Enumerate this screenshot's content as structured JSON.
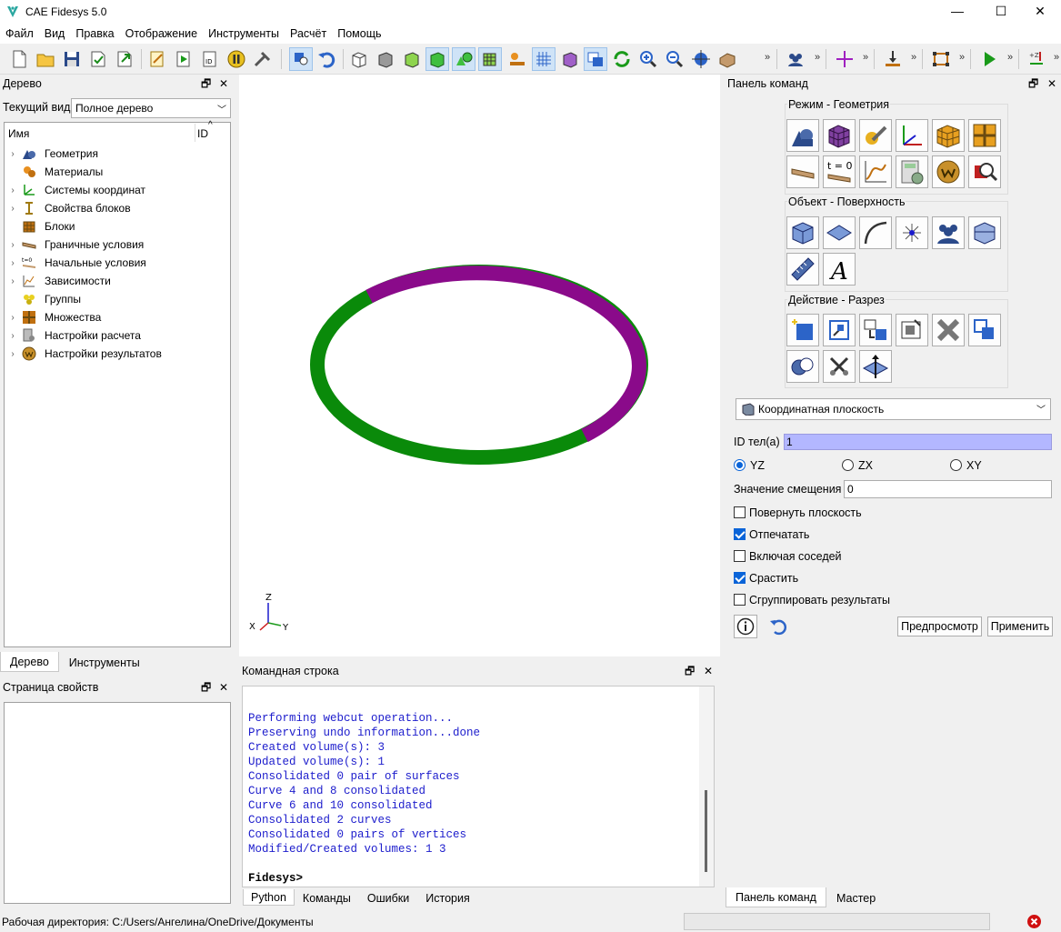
{
  "window": {
    "title": "CAE Fidesys 5.0",
    "minimize": "—",
    "maximize": "☐",
    "close": "✕"
  },
  "menu": [
    "Файл",
    "Вид",
    "Правка",
    "Отображение",
    "Инструменты",
    "Расчёт",
    "Помощь"
  ],
  "tree_panel": {
    "title": "Дерево",
    "view_label": "Текущий вид",
    "view_value": "Полное дерево",
    "col_name": "Имя",
    "col_id": "ID",
    "items": [
      {
        "label": "Геометрия",
        "icon": "geometry-icon",
        "expandable": true
      },
      {
        "label": "Материалы",
        "icon": "materials-icon",
        "expandable": false
      },
      {
        "label": "Системы координат",
        "icon": "coordinate-systems-icon",
        "expandable": true
      },
      {
        "label": "Свойства блоков",
        "icon": "block-properties-icon",
        "expandable": true
      },
      {
        "label": "Блоки",
        "icon": "blocks-icon",
        "expandable": false
      },
      {
        "label": "Граничные условия",
        "icon": "boundary-conditions-icon",
        "expandable": true
      },
      {
        "label": "Начальные условия",
        "icon": "initial-conditions-icon",
        "expandable": true
      },
      {
        "label": "Зависимости",
        "icon": "dependencies-icon",
        "expandable": true
      },
      {
        "label": "Группы",
        "icon": "groups-icon",
        "expandable": false
      },
      {
        "label": "Множества",
        "icon": "sets-icon",
        "expandable": true
      },
      {
        "label": "Настройки расчета",
        "icon": "analysis-settings-icon",
        "expandable": true
      },
      {
        "label": "Настройки результатов",
        "icon": "results-settings-icon",
        "expandable": true
      }
    ],
    "tabs": [
      "Дерево",
      "Инструменты"
    ]
  },
  "properties_panel": {
    "title": "Страница свойств"
  },
  "viewport": {
    "axis_z": "Z",
    "axis_y": "Y",
    "axis_x": "X",
    "colors": {
      "green": "#0a8a0a",
      "purple": "#8a0a8a"
    }
  },
  "command_line": {
    "title": "Командная строка",
    "lines": [
      "Performing webcut operation...",
      "Preserving undo information...done",
      "Created volume(s): 3",
      "Updated volume(s): 1",
      "Consolidated 0 pair of surfaces",
      "Curve 4 and 8 consolidated",
      "Curve 6 and 10 consolidated",
      "Consolidated 2 curves",
      "Consolidated 0 pairs of vertices",
      "Modified/Created volumes: 1 3"
    ],
    "prompt": "Fidesys>",
    "tabs": [
      "Python",
      "Команды",
      "Ошибки",
      "История"
    ]
  },
  "command_panel": {
    "title": "Панель команд",
    "mode_group": "Режим - Геометрия",
    "object_group": "Объект - Поверхность",
    "action_group": "Действие - Разрез",
    "t0_label": "t = 0",
    "dropdown_value": "Координатная плоскость",
    "body_id_label": "ID тел(а)",
    "body_id_value": "1",
    "radio": [
      "YZ",
      "ZX",
      "XY"
    ],
    "offset_label": "Значение смещения",
    "offset_value": "0",
    "checks": [
      {
        "label": "Повернуть плоскость",
        "checked": false
      },
      {
        "label": "Отпечатать",
        "checked": true
      },
      {
        "label": "Включая соседей",
        "checked": false
      },
      {
        "label": "Срастить",
        "checked": true
      },
      {
        "label": "Сгруппировать результаты",
        "checked": false
      }
    ],
    "preview_button": "Предпросмотр",
    "apply_button": "Применить",
    "tabs": [
      "Панель команд",
      "Мастер"
    ]
  },
  "status": {
    "working_dir": "Рабочая директория: C:/Users/Ангелина/OneDrive/Документы"
  }
}
